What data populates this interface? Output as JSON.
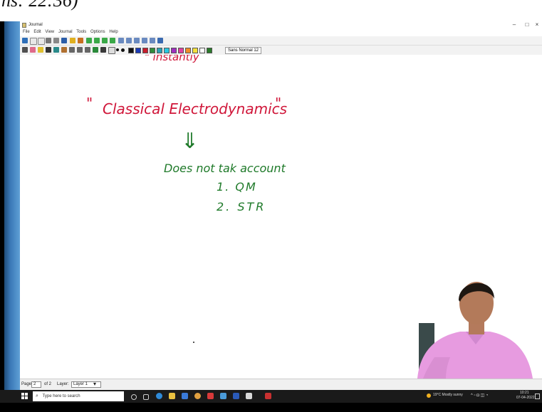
{
  "caption": {
    "text": "ns: 22:36)"
  },
  "window": {
    "title": "Journal",
    "controls": {
      "minimize": "–",
      "maximize": "□",
      "close": "×"
    },
    "menu": [
      "File",
      "Edit",
      "View",
      "Journal",
      "Tools",
      "Options",
      "Help"
    ],
    "font_label": "Sans Normal 12"
  },
  "toolbar_colors": [
    "#111111",
    "#1a3ab8",
    "#c81c2c",
    "#2f8c3c",
    "#2aa0b4",
    "#28c8e0",
    "#a030c0",
    "#e040a0",
    "#f08c28",
    "#f4e03c",
    "#ffffff",
    "#2a7a2a"
  ],
  "canvas": {
    "red_partial": "\" instantly",
    "title_open_quote": "\"",
    "title": "Classical Electrodynamics",
    "title_close_quote": "\"",
    "arrow": "⇓",
    "note": "Does not tak account",
    "item1": "1. QM",
    "item2": "2. STR"
  },
  "statusbar": {
    "page_label": "Page",
    "page_value": "2",
    "of_label": "of 2",
    "layer_label": "Layer:",
    "layer_value": "Layer 1"
  },
  "taskbar": {
    "search_placeholder": "Type here to search",
    "weather": "19°C Mostly sunny",
    "time": "10:21",
    "date": "07-04-2022"
  },
  "icons": [
    "windows-start-icon",
    "search-icon",
    "task-view-icon",
    "edge-icon",
    "file-explorer-icon",
    "store-icon",
    "mail-icon"
  ]
}
